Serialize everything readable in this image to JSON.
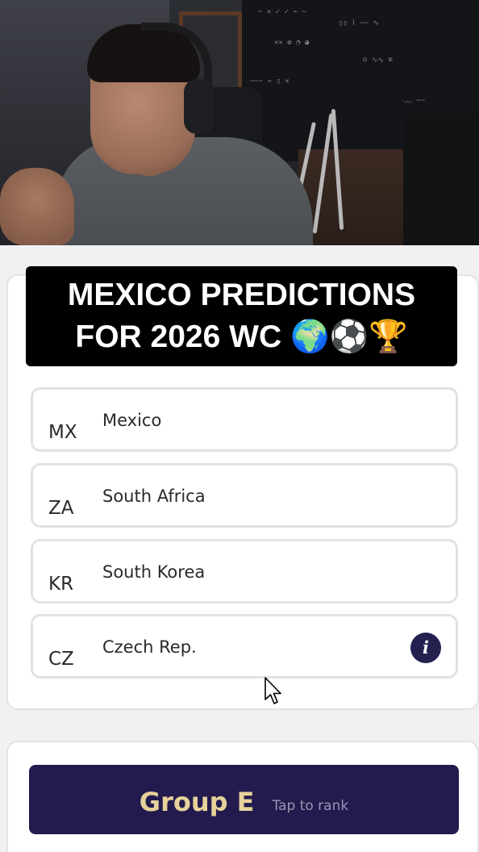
{
  "overlay": {
    "line1": "MEXICO PREDICTIONS",
    "line2": "FOR 2026 WC 🌍⚽🏆"
  },
  "group_card": {
    "teams": [
      {
        "code": "MX",
        "name": "Mexico"
      },
      {
        "code": "ZA",
        "name": "South Africa"
      },
      {
        "code": "KR",
        "name": "South Korea"
      },
      {
        "code": "CZ",
        "name": "Czech Rep."
      }
    ]
  },
  "next_group": {
    "name": "Group E",
    "hint": "Tap to rank"
  },
  "colors": {
    "accent": "#231b4e",
    "group_text": "#e6d29a",
    "info_icon": "#24204f"
  },
  "icons": {
    "info": "info-icon",
    "cursor": "mouse-pointer-icon"
  }
}
